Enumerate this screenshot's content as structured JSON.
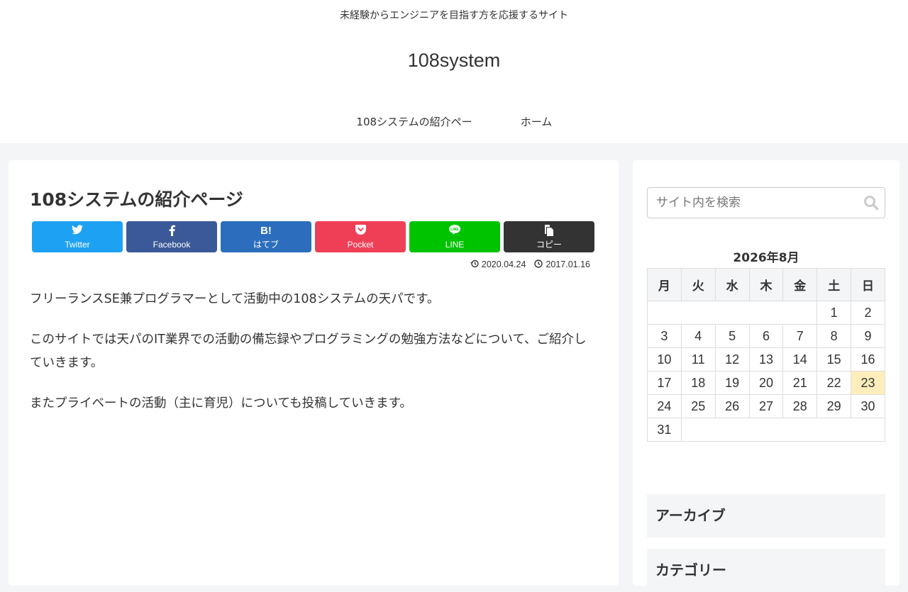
{
  "header": {
    "tagline": "未経験からエンジニアを目指す方を応援するサイト",
    "site_name": "108system",
    "nav": [
      "108システムの紹介ペー",
      "ホーム"
    ]
  },
  "article": {
    "title": "108システムの紹介ページ",
    "share_buttons": [
      {
        "label": "Twitter",
        "icon": "twitter-icon",
        "color": "#1da1f2"
      },
      {
        "label": "Facebook",
        "icon": "facebook-icon",
        "color": "#3b5998"
      },
      {
        "label": "はてブ",
        "icon": "hatena-bookmark-icon",
        "color": "#2c6ebd"
      },
      {
        "label": "Pocket",
        "icon": "pocket-icon",
        "color": "#ef3f56"
      },
      {
        "label": "LINE",
        "icon": "line-icon",
        "color": "#00c300"
      },
      {
        "label": "コピー",
        "icon": "copy-icon",
        "color": "#333333"
      }
    ],
    "updated_date": "2020.04.24",
    "published_date": "2017.01.16",
    "paragraphs": [
      "フリーランスSE兼プログラマーとして活動中の108システムの天パです。",
      "このサイトでは天パのIT業界での活動の備忘録やプログラミングの勉強方法などについて、ご紹介していきます。",
      "またプライベートの活動（主に育児）についても投稿していきます。"
    ]
  },
  "sidebar": {
    "search_placeholder": "サイト内を検索",
    "calendar": {
      "caption": "2026年8月",
      "weekdays": [
        "月",
        "火",
        "水",
        "木",
        "金",
        "土",
        "日"
      ],
      "weeks": [
        [
          "",
          "",
          "",
          "",
          "",
          "1",
          "2"
        ],
        [
          "3",
          "4",
          "5",
          "6",
          "7",
          "8",
          "9"
        ],
        [
          "10",
          "11",
          "12",
          "13",
          "14",
          "15",
          "16"
        ],
        [
          "17",
          "18",
          "19",
          "20",
          "21",
          "22",
          "23"
        ],
        [
          "24",
          "25",
          "26",
          "27",
          "28",
          "29",
          "30"
        ],
        [
          "31",
          "",
          "",
          "",
          "",
          "",
          ""
        ]
      ],
      "today": "23"
    },
    "widgets": [
      "アーカイブ",
      "カテゴリー"
    ]
  }
}
